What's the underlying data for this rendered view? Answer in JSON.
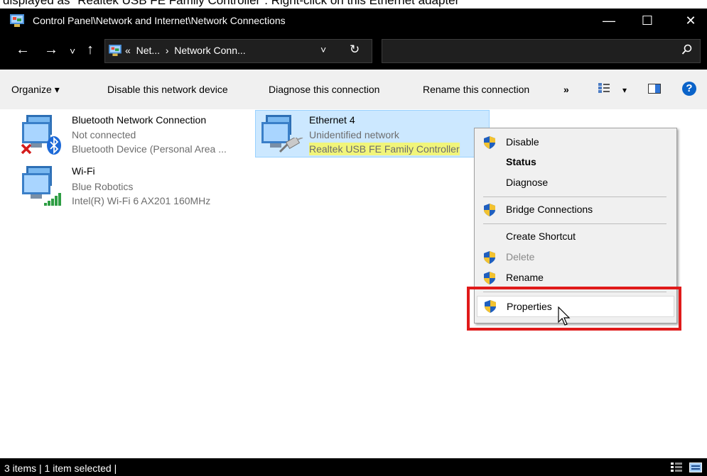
{
  "caption": "displayed as \"Realtek USB FE Family Controller\". Right-click on this Ethernet adapter",
  "window": {
    "title": "Control Panel\\Network and Internet\\Network Connections",
    "minimize": "—",
    "maximize": "☐",
    "close": "✕"
  },
  "nav": {
    "back": "←",
    "forward": "→",
    "recent": "˅",
    "up": "↑",
    "breadcrumb_sep": "«",
    "crumb1": "Net...",
    "crumb_arrow": "›",
    "crumb2": "Network Conn...",
    "dropdown": "˅",
    "refresh": "↻",
    "search_placeholder": ""
  },
  "toolbar": {
    "organize": "Organize ▾",
    "disable": "Disable this network device",
    "diagnose": "Diagnose this connection",
    "rename": "Rename this connection",
    "more": "»",
    "view_dropdown": "▾",
    "help": "?"
  },
  "connections": [
    {
      "name": "Bluetooth Network Connection",
      "status": "Not connected",
      "device": "Bluetooth Device (Personal Area ..."
    },
    {
      "name": "Ethernet 4",
      "status": "Unidentified network",
      "device": "Realtek USB FE Family Controller"
    },
    {
      "name": "Wi-Fi",
      "status": "Blue Robotics",
      "device": "Intel(R) Wi-Fi 6 AX201 160MHz"
    }
  ],
  "context_menu": {
    "disable": "Disable",
    "status": "Status",
    "diagnose": "Diagnose",
    "bridge": "Bridge Connections",
    "shortcut": "Create Shortcut",
    "delete": "Delete",
    "rename": "Rename",
    "properties": "Properties"
  },
  "status_bar": {
    "text": "3 items  |  1 item selected  |"
  },
  "colors": {
    "selection": "#cce8ff",
    "highlight": "#f1f57a",
    "annotation": "#e01a1a",
    "help": "#0a63c9"
  }
}
